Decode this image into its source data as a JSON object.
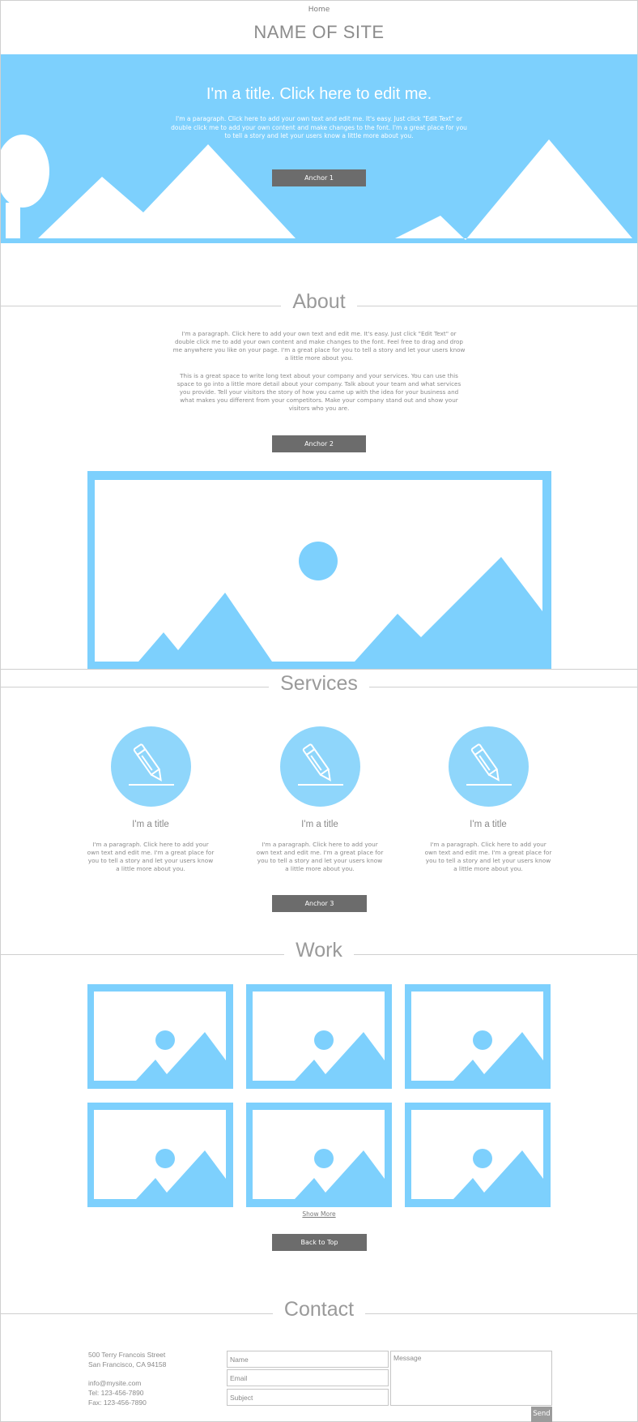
{
  "header": {
    "nav_home": "Home",
    "site_name": "NAME OF SITE"
  },
  "hero": {
    "title": "I'm a title. Click here to edit me.",
    "paragraph": "I'm a paragraph. Click here to add your own text and edit me. It's easy. Just click \"Edit Text\" or double click me to add your own content and make changes to the font. I'm a great place for you to tell a story and let your users know a little more about you.",
    "button": "Anchor 1",
    "background_color": "#7dd0fd"
  },
  "about": {
    "heading": "About",
    "paragraph_1": "I'm a paragraph. Click here to add your own text and edit me. It's easy. Just click \"Edit Text\" or double click me to add your own content and make changes to the font. Feel free to drag and drop me anywhere you like on your page. I'm a great place for you to tell a story and let your users know a little more about you.",
    "paragraph_2": "This is a great space to write long text about your company and your services. You can use this space to go into a little more detail about your company. Talk about your team and what services you provide. Tell your visitors the story of how you came up with the idea for your business and what makes you different from your competitors. Make your company stand out and show your visitors who you are.",
    "button": "Anchor 2",
    "image_icon": "image-placeholder-icon"
  },
  "services": {
    "heading": "Services",
    "items": [
      {
        "icon": "pencil-icon",
        "title": "I'm a title",
        "text": "I'm a paragraph. Click here to add your own text and edit me. I'm a great place for you to tell a story and let your users know a little more about you."
      },
      {
        "icon": "pencil-icon",
        "title": "I'm a title",
        "text": "I'm a paragraph. Click here to add your own text and edit me. I'm a great place for you to tell a story and let your users know a little more about you."
      },
      {
        "icon": "pencil-icon",
        "title": "I'm a title",
        "text": "I'm a paragraph. Click here to add your own text and edit me. I'm a great place for you to tell a story and let your users know a little more about you."
      }
    ],
    "button": "Anchor 3"
  },
  "work": {
    "heading": "Work",
    "thumbnail_count": 6,
    "show_more": "Show More",
    "back_to_top": "Back to Top"
  },
  "contact": {
    "heading": "Contact",
    "address_line_1": "500 Terry Francois Street",
    "address_line_2": "San Francisco, CA  94158",
    "email": "info@mysite.com",
    "tel": "Tel: 123-456-7890",
    "fax": "Fax: 123-456-7890",
    "form": {
      "name_placeholder": "Name",
      "email_placeholder": "Email",
      "subject_placeholder": "Subject",
      "message_placeholder": "Message",
      "send": "Send"
    }
  },
  "colors": {
    "accent": "#7dd0fd",
    "service_circle": "#8fd6fb",
    "button": "#6c6c6c",
    "heading_text": "#9a9a9a"
  }
}
